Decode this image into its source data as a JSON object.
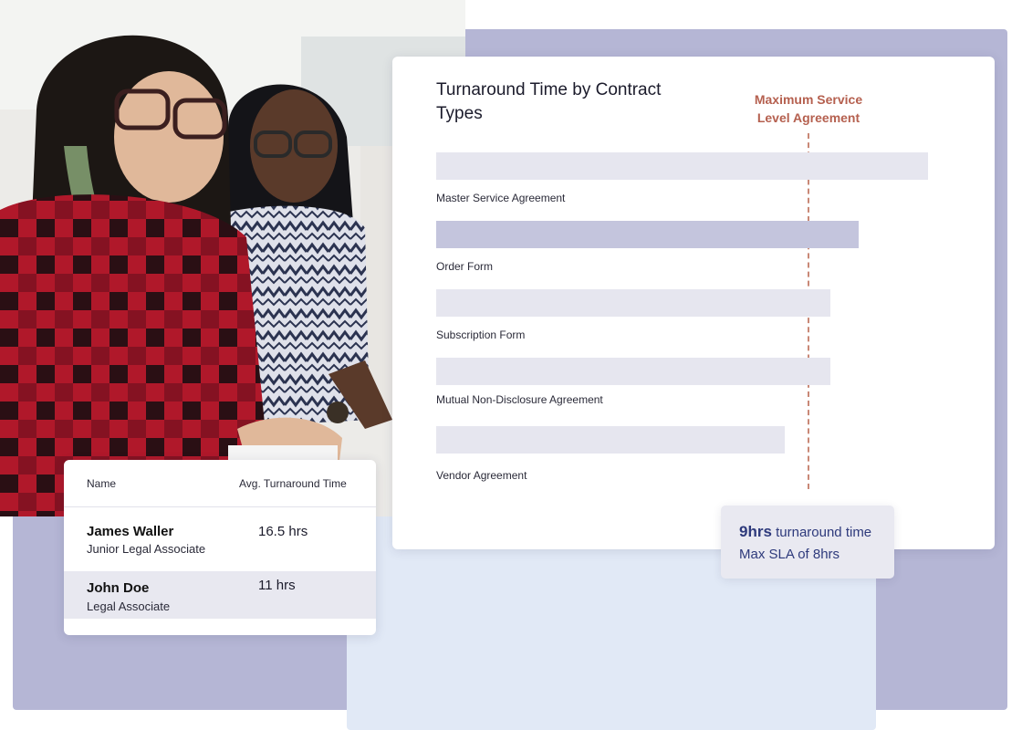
{
  "chart_data": {
    "type": "bar",
    "title": "Turnaround Time by Contract Types",
    "categories": [
      "Master Service Agreement",
      "Order Form",
      "Subscription Form",
      "Mutual Non-Disclosure Agreement",
      "Vendor Agreement"
    ],
    "values": [
      10.6,
      9.1,
      8.5,
      8.5,
      7.5
    ],
    "sla_line": {
      "label": "Maximum Service Level Agreement",
      "value": 8
    },
    "colors": {
      "bar_light": "#e6e6ef",
      "bar_highlight": "#c4c5dd",
      "sla": "#b5604f"
    }
  },
  "tooltip": {
    "hours": "9hrs",
    "text": "turnaround time",
    "line2": "Max SLA of 8hrs"
  },
  "table": {
    "headers": {
      "name": "Name",
      "time": "Avg. Turnaround Time"
    },
    "rows": [
      {
        "name": "James Waller",
        "role": "Junior Legal Associate",
        "time": "16.5 hrs"
      },
      {
        "name": "John Doe",
        "role": "Legal Associate",
        "time": "11 hrs"
      }
    ]
  }
}
